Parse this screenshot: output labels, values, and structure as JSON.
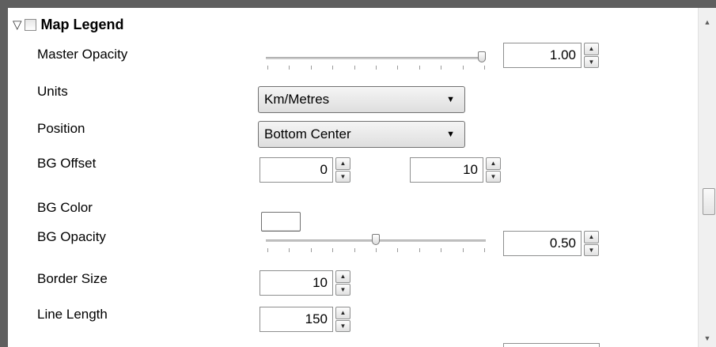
{
  "legend": {
    "title": "Map Legend",
    "enabled": false,
    "expanded": true
  },
  "rows": {
    "master_opacity": {
      "label": "Master Opacity",
      "value": "1.00",
      "slider_fraction": 1.0
    },
    "units": {
      "label": "Units",
      "selected": "Km/Metres"
    },
    "position": {
      "label": "Position",
      "selected": "Bottom Center"
    },
    "bg_offset": {
      "label": "BG Offset",
      "x": "0",
      "y": "10"
    },
    "bg_color": {
      "label": "BG Color",
      "color": "#ffffff"
    },
    "bg_opacity": {
      "label": "BG Opacity",
      "value": "0.50",
      "slider_fraction": 0.5
    },
    "border_size": {
      "label": "Border Size",
      "value": "10"
    },
    "line_length": {
      "label": "Line Length",
      "value": "150"
    }
  },
  "icons": {
    "expand": "triangle-down-outline-icon",
    "spin_up": "chevron-up-icon",
    "spin_down": "chevron-down-icon",
    "dropdown": "caret-down-icon",
    "scroll_up": "scroll-up-arrow-icon",
    "scroll_down": "scroll-down-arrow-icon"
  }
}
